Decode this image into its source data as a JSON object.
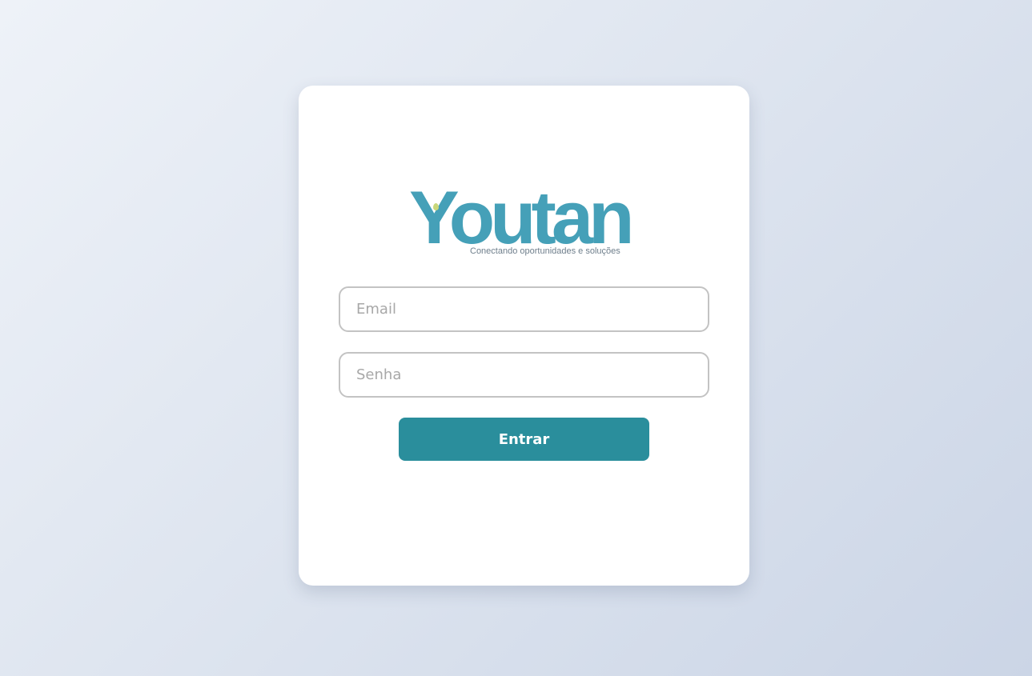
{
  "brand": {
    "name": "Youtan",
    "tagline": "Conectando oportunidades e soluções",
    "color": "#45a0b8",
    "accent_dot_color": "#c9d77a"
  },
  "form": {
    "email_placeholder": "Email",
    "email_value": "",
    "password_placeholder": "Senha",
    "password_value": "",
    "submit_label": "Entrar",
    "submit_color": "#2a8e9c"
  }
}
